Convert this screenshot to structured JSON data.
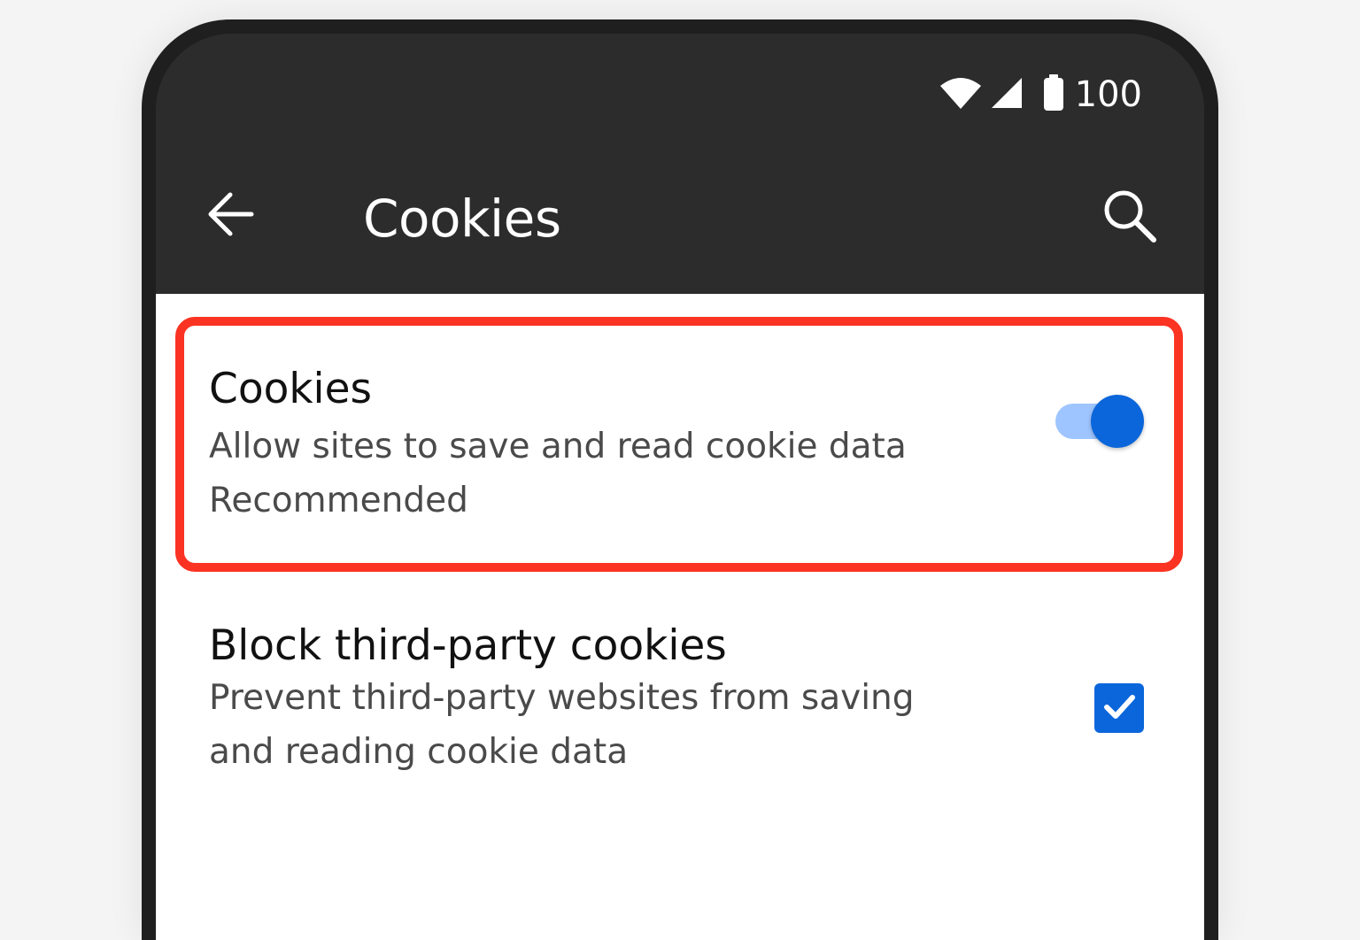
{
  "status_bar": {
    "battery_level": "100",
    "icons": [
      "wifi-icon",
      "cellular-signal-icon",
      "battery-icon"
    ]
  },
  "app_bar": {
    "title": "Cookies",
    "back_icon": "arrow-left-icon",
    "search_icon": "search-icon"
  },
  "settings": [
    {
      "title": "Cookies",
      "description": "Allow sites to save and read cookie data",
      "note": "Recommended",
      "control": "toggle",
      "checked": true,
      "highlighted": true
    },
    {
      "title": "Block third-party cookies",
      "description": "Prevent third-party websites from saving and reading cookie data",
      "control": "checkbox",
      "checked": true
    }
  ],
  "colors": {
    "app_bar_bg": "#2c2c2c",
    "accent": "#0b66db",
    "toggle_track": "#9ec5ff",
    "highlight": "#fb3323"
  }
}
